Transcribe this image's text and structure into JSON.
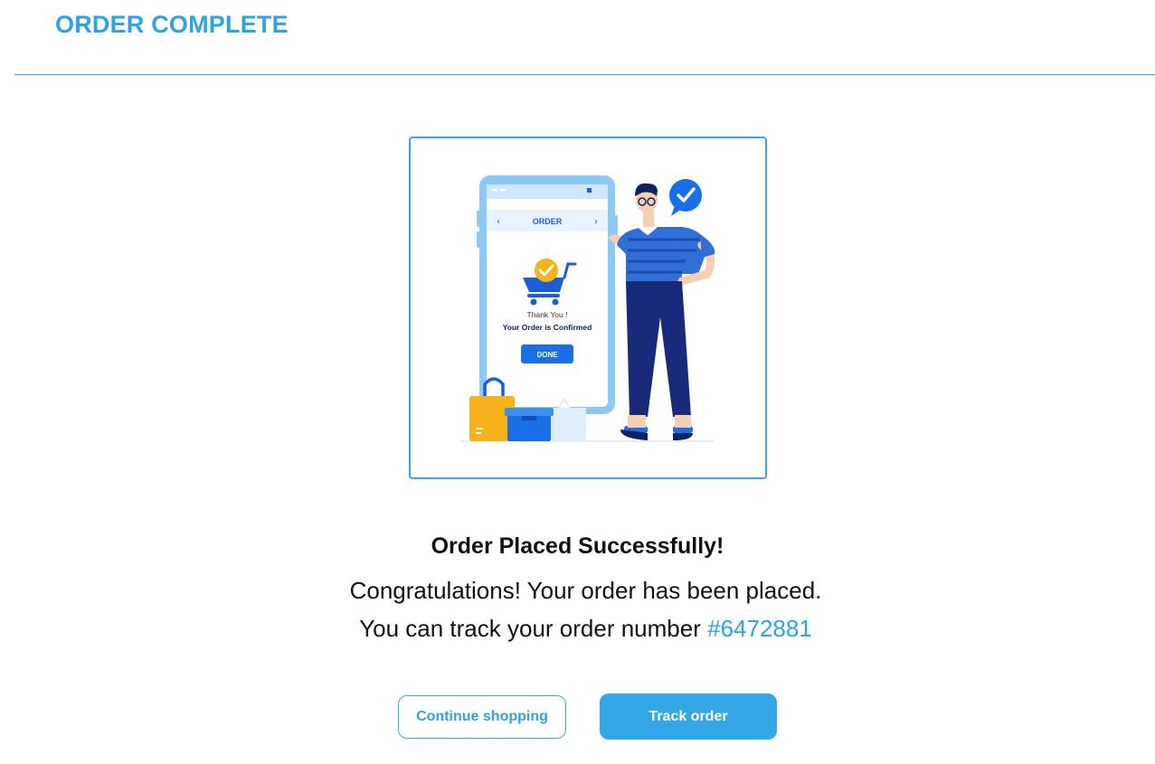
{
  "header": {
    "title": "ORDER COMPLETE"
  },
  "illustration": {
    "phone_header": "ORDER",
    "thank_you": "Thank You !",
    "confirmed": "Your Order is Confirmed",
    "done_label": "DONE",
    "icons": [
      "chevron-left-icon",
      "chevron-right-icon",
      "shopping-cart-icon",
      "check-badge-icon",
      "shopping-bag-icon",
      "box-icon",
      "chat-check-icon"
    ]
  },
  "content": {
    "heading": "Order Placed Successfully!",
    "line1": "Congratulations! Your order has been placed.",
    "line2_prefix": "You can track your order number ",
    "order_number": "#6472881"
  },
  "actions": {
    "continue_label": "Continue shopping",
    "track_label": "Track order"
  },
  "colors": {
    "accent": "#2fa3e0",
    "primary_button": "#33a6e6",
    "phone_frame": "#8ec9f5",
    "shirt": "#2f6fd6",
    "pants": "#1a2a7a",
    "bag": "#f5b21b"
  }
}
